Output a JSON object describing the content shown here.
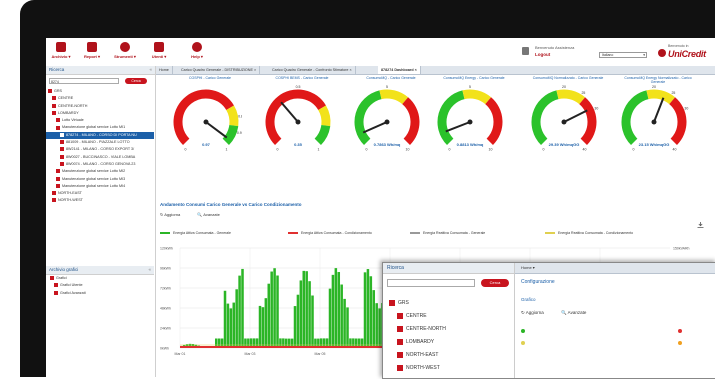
{
  "toolbar": {
    "items": [
      {
        "label": "Archivio ▾",
        "icon": "archive-icon"
      },
      {
        "label": "Report ▾",
        "icon": "report-icon"
      },
      {
        "label": "Strumenti ▾",
        "icon": "tools-icon"
      },
      {
        "label": "Utenti ▾",
        "icon": "users-icon"
      },
      {
        "label": "Help ▾",
        "icon": "help-icon"
      }
    ],
    "welcome": "Benvenuto Assistenza",
    "logout": "Logout",
    "language": "Italiano",
    "brand_small": "Benvenuto in",
    "brand_name": "UniCredit"
  },
  "left_panel": {
    "title": "Ricerca",
    "search_value": "8274",
    "search_button": "Cerca",
    "tree": [
      {
        "label": "GRS",
        "indent": 0
      },
      {
        "label": "CENTRE",
        "indent": 1
      },
      {
        "label": "CENTRE-NORTH",
        "indent": 1
      },
      {
        "label": "LOMBARDY",
        "indent": 1
      },
      {
        "label": "Lotto Virtuale",
        "indent": 2
      },
      {
        "label": "Manutenzione global service Lotto MI1",
        "indent": 2
      },
      {
        "label": "878274 - MILANO - CORSO DI PORTA NU",
        "indent": 3,
        "selected": true
      },
      {
        "label": "881009 - MILANO - PIAZZALE LOTTO",
        "indent": 3
      },
      {
        "label": "8W2141 - MILANO - CORSO EXPORT 3/",
        "indent": 3
      },
      {
        "label": "8W0027 - BUCCINASCO - VIALE LOMBA",
        "indent": 3
      },
      {
        "label": "8W0074 - MILANO - CORSO GENOVA 23",
        "indent": 3
      },
      {
        "label": "Manutenzione global service Lotto MI2",
        "indent": 2
      },
      {
        "label": "Manutenzione global service Lotto MI3",
        "indent": 2
      },
      {
        "label": "Manutenzione global service Lotto MI4",
        "indent": 2
      },
      {
        "label": "NORTH-EAST",
        "indent": 1
      },
      {
        "label": "NORTH-WEST",
        "indent": 1
      }
    ],
    "panel2_title": "Archivio grafici",
    "panel2_items": [
      "Grafici",
      "Grafici Utente",
      "Grafici Avanzati"
    ]
  },
  "tabs": [
    "Home",
    "Carico Quadro Generale - DISTRIBUZIONE ×",
    "Carico Quadro Generale - Confronto Stimatore ×",
    "878274 Dashboard ×"
  ],
  "gauges": [
    {
      "title": "COSPHI - Carico Generale",
      "value": 0.97,
      "min": 0,
      "max": 1,
      "min_label": "0",
      "max_label": "1",
      "extra_ticks": [
        "0.8",
        "0.9"
      ],
      "value_label": "0.97"
    },
    {
      "title": "COSPHI BEMS - Carico Generale",
      "value": 0.35,
      "min": 0,
      "max": 1,
      "min_label": "0",
      "max_label": "1",
      "extra_ticks": [
        "0.5"
      ],
      "value_label": "0.35"
    },
    {
      "title": "ConsumoMQ - Carico Generale",
      "value": 0.7863,
      "min": 0,
      "max": 10,
      "min_label": "0",
      "max_label": "10",
      "extra_ticks": [
        "5"
      ],
      "value_label": "0.7863 Wh/mq"
    },
    {
      "title": "ConsumoMQ Energy - Carico Generale",
      "value": 0.8813,
      "min": 0,
      "max": 10,
      "min_label": "0",
      "max_label": "10",
      "extra_ticks": [
        "5"
      ],
      "value_label": "0.8813 Wh/mq"
    },
    {
      "title": "ConsumoMQ Normalizzato - Carico Generale",
      "value": 29.39,
      "min": 0,
      "max": 40,
      "min_label": "0",
      "max_label": "40",
      "extra_ticks": [
        "20",
        "25",
        "30"
      ],
      "value_label": "29.39 Wh/mqGG"
    },
    {
      "title": "ConsumoMQ Energy Normalizzato - Carico Generale",
      "value": 23.15,
      "min": 0,
      "max": 40,
      "min_label": "0",
      "max_label": "40",
      "extra_ticks": [
        "20",
        "25",
        "30"
      ],
      "value_label": "23.15 Wh/mqGG"
    }
  ],
  "section": {
    "title": "Andamento Consumi Carico Generale vs Carico Condizionamento",
    "refresh": "Aggiorna",
    "advanced": "Avanzate"
  },
  "chart_data": {
    "type": "bar",
    "title": "",
    "series": [
      {
        "name": "Energia Attiva Consumata - Generale",
        "color": "#2bb526"
      },
      {
        "name": "Energia Attiva Consumata - Condizionamento",
        "color": "#e03030"
      },
      {
        "name": "Energia Reattiva Consumata - Generale",
        "color": "#999999"
      },
      {
        "name": "Energia Reattiva Consumata - Condizionamento",
        "color": "#e0d050"
      }
    ],
    "y_ticks_left": [
      "120kWh",
      "96kWh",
      "72kWh",
      "48kWh",
      "24kWh",
      "0kWh"
    ],
    "y_ticks_right": [
      "150kVARh",
      "120kVARh",
      "90kVARh",
      "60kVARh",
      "30kVARh",
      "0kVARh"
    ],
    "x_ticks": [
      "Mar 01",
      "Mar 03",
      "Mar 05",
      "Mar 07",
      "Mar 09",
      "Mar 11",
      "Mar 13"
    ],
    "ylim": [
      0,
      120
    ],
    "daily_peaks": [
      5,
      95,
      96,
      94,
      96,
      95,
      10,
      6,
      0,
      0,
      0,
      0,
      0,
      0
    ],
    "grid": true,
    "legend": "top"
  },
  "overlay": {
    "left_title": "Ricerca",
    "search_button": "Cerca",
    "tree": [
      "GRS",
      "CENTRE",
      "CENTRE-NORTH",
      "LOMBARDY",
      "NORTH-EAST",
      "NORTH-WEST",
      "SOUTH"
    ],
    "tab_label": "Home ▾",
    "title": "Configurazione",
    "subtitle": "Grafico",
    "refresh": "Aggiorna",
    "advanced": "Avanzate"
  }
}
